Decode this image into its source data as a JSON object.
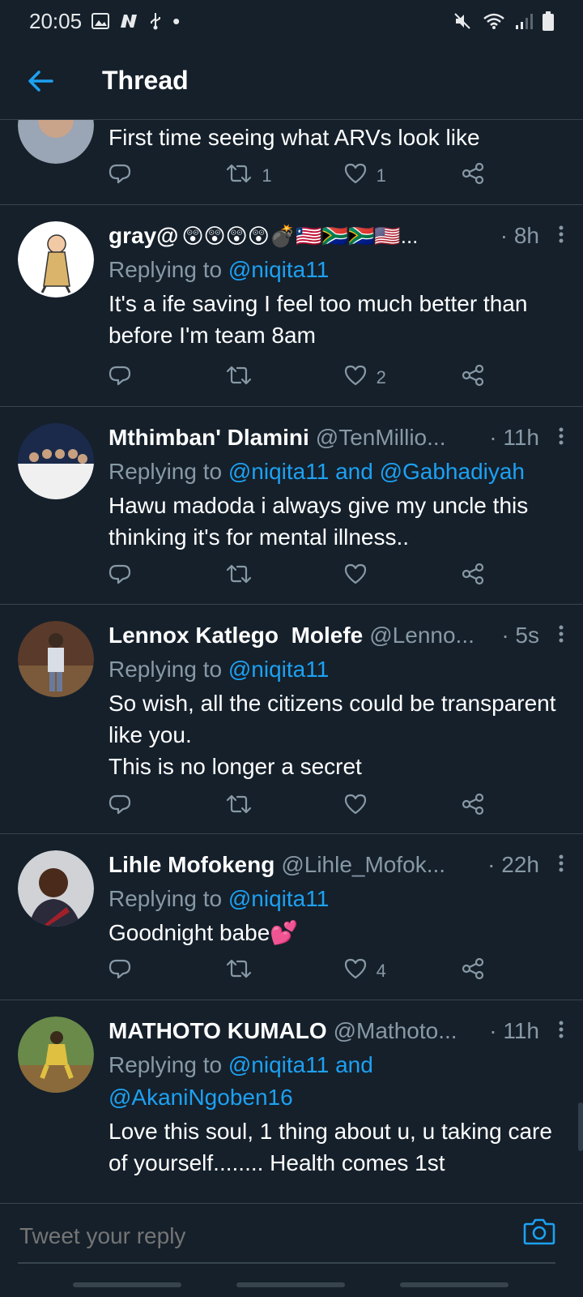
{
  "status_bar": {
    "time": "20:05",
    "dot": "•"
  },
  "app_bar": {
    "title": "Thread"
  },
  "partial_tweet": {
    "text": "First time seeing what ARVs look like",
    "retweets": "1",
    "likes": "1"
  },
  "tweets": [
    {
      "name": "gray@",
      "name_emoji": "😲😲😲😲💣🇱🇷🇿🇦🇿🇦🇺🇸...",
      "handle": "",
      "time": "· 8h",
      "replying_prefix": "Replying to",
      "replying_to": "@niqita11",
      "text": "It's a ife saving I feel too much better than before I'm team 8am",
      "retweets": "",
      "likes": "2"
    },
    {
      "name": "Mthimban' Dlamini",
      "handle": "@TenMillio...",
      "time": "· 11h",
      "replying_prefix": "Replying to",
      "replying_to": "@niqita11 and @Gabhadiyah",
      "text": "Hawu madoda i always give my uncle this thinking it's for mental illness..",
      "retweets": "",
      "likes": ""
    },
    {
      "name": "Lennox Katlego  Molefe",
      "handle": "@Lenno...",
      "time": "· 5s",
      "replying_prefix": "Replying to",
      "replying_to": "@niqita11",
      "text": "So wish, all the citizens could be transparent like you.\nThis is no longer a secret",
      "retweets": "",
      "likes": ""
    },
    {
      "name": "Lihle Mofokeng",
      "handle": "@Lihle_Mofok...",
      "time": "· 22h",
      "replying_prefix": "Replying to",
      "replying_to": "@niqita11",
      "text": "Goodnight babe💕",
      "retweets": "",
      "likes": "4"
    },
    {
      "name": "MATHOTO KUMALO",
      "handle": "@Mathoto...",
      "time": "· 11h",
      "replying_prefix": "Replying to",
      "replying_to": "@niqita11 and @AkaniNgoben16",
      "text": "Love this soul, 1 thing about u, u taking care of yourself........ Health comes 1st",
      "retweets": "",
      "likes": ""
    }
  ],
  "reply_bar": {
    "placeholder": "Tweet your reply"
  },
  "colors": {
    "background": "#15202b",
    "accent": "#1da1f2",
    "muted": "#8899a6",
    "divider": "#38444d"
  }
}
